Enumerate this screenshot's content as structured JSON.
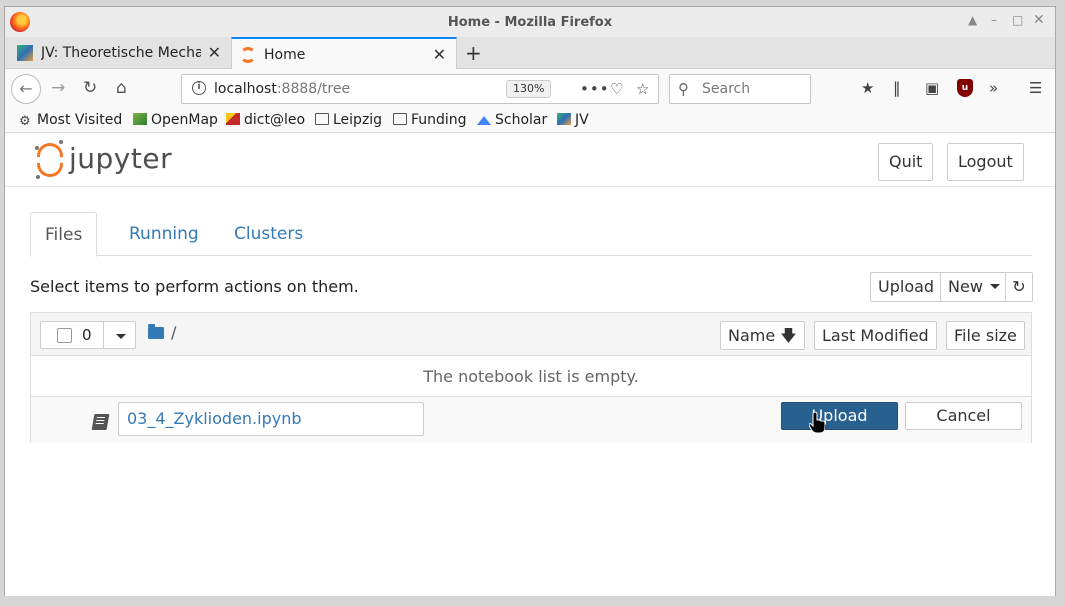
{
  "window": {
    "title": "Home - Mozilla Firefox"
  },
  "tabs": [
    {
      "label": "JV: Theoretische Mechanik",
      "active": false
    },
    {
      "label": "Home",
      "active": true
    }
  ],
  "navbar": {
    "url_host": "localhost",
    "url_rest": ":8888/tree",
    "zoom": "130%",
    "search_placeholder": "Search"
  },
  "bookmarks": [
    {
      "label": "Most Visited",
      "icon": "gear-icon"
    },
    {
      "label": "OpenMap",
      "icon": "map-icon"
    },
    {
      "label": "dict@leo",
      "icon": "leo-icon"
    },
    {
      "label": "Leipzig",
      "icon": "folder-icon"
    },
    {
      "label": "Funding",
      "icon": "folder-icon"
    },
    {
      "label": "Scholar",
      "icon": "scholar-icon"
    },
    {
      "label": "JV",
      "icon": "jv-icon"
    }
  ],
  "jupyter": {
    "logo_text": "jupyter",
    "quit_label": "Quit",
    "logout_label": "Logout",
    "tabs": [
      "Files",
      "Running",
      "Clusters"
    ],
    "active_tab": "Files",
    "hint": "Select items to perform actions on them.",
    "upload_label": "Upload",
    "new_label": "New",
    "selected_count": "0",
    "breadcrumb": "/",
    "sort_name": "Name",
    "sort_modified": "Last Modified",
    "sort_size": "File size",
    "empty_message": "The notebook list is empty.",
    "upload_row": {
      "filename": "03_4_Zyklioden.ipynb",
      "upload_button": "Upload",
      "cancel_button": "Cancel"
    }
  },
  "colors": {
    "accent_tab": "#0a84ff",
    "jupyter_orange": "#f37726",
    "link_blue": "#337ab7",
    "primary_button": "#286090"
  }
}
